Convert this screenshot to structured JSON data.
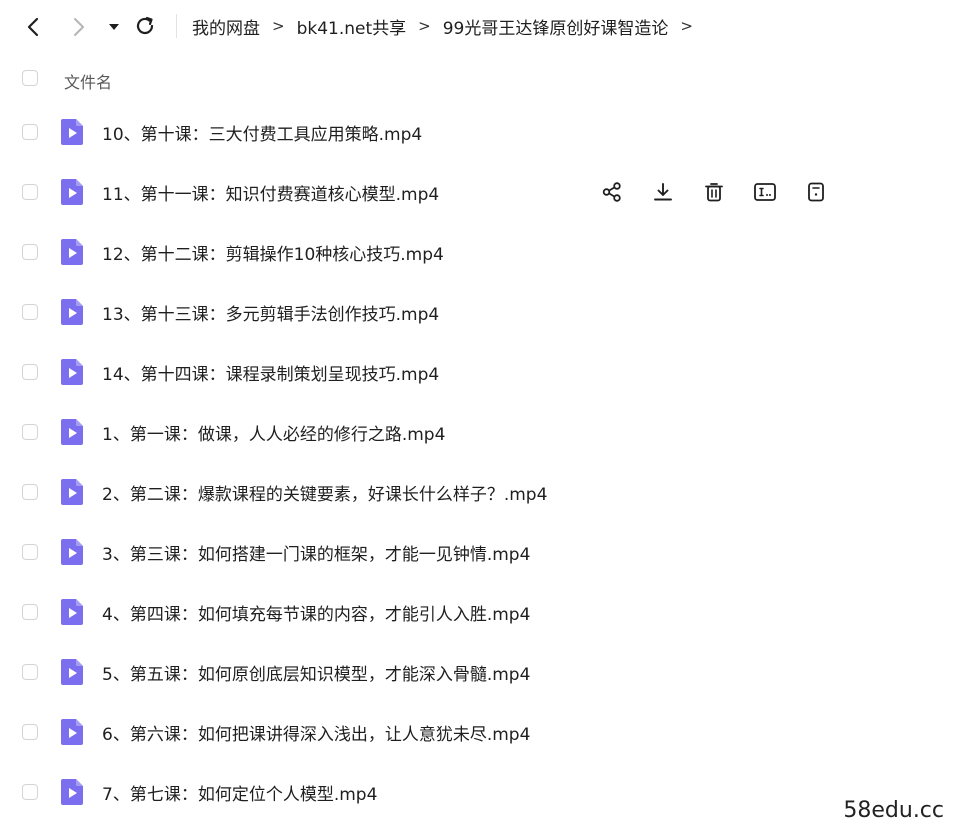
{
  "toolbar": {
    "back_icon": "chevron-left-icon",
    "forward_icon": "chevron-right-icon",
    "dropdown_icon": "caret-down-icon",
    "refresh_icon": "refresh-icon"
  },
  "breadcrumb": {
    "items": [
      "我的网盘",
      "bk41.net共享",
      "99光哥王达锋原创好课智造论"
    ],
    "separator": ">"
  },
  "list": {
    "header_label": "文件名",
    "file_icon_color": "#7b6ff0",
    "files": [
      {
        "name": "10、第十课：三大付费工具应用策略.mp4"
      },
      {
        "name": "11、第十一课：知识付费赛道核心模型.mp4"
      },
      {
        "name": "12、第十二课：剪辑操作10种核心技巧.mp4"
      },
      {
        "name": "13、第十三课：多元剪辑手法创作技巧.mp4"
      },
      {
        "name": "14、第十四课：课程录制策划呈现技巧.mp4"
      },
      {
        "name": "1、第一课：做课，人人必经的修行之路.mp4"
      },
      {
        "name": "2、第二课：爆款课程的关键要素，好课长什么样子？.mp4"
      },
      {
        "name": "3、第三课：如何搭建一门课的框架，才能一见钟情.mp4"
      },
      {
        "name": "4、第四课：如何填充每节课的内容，才能引人入胜.mp4"
      },
      {
        "name": "5、第五课：如何原创底层知识模型，才能深入骨髓.mp4"
      },
      {
        "name": "6、第六课：如何把课讲得深入浅出，让人意犹未尽.mp4"
      },
      {
        "name": "7、第七课：如何定位个人模型.mp4"
      }
    ],
    "hover_actions": [
      "share-icon",
      "download-icon",
      "delete-icon",
      "rename-icon",
      "details-icon"
    ]
  },
  "watermark": "58edu.cc"
}
